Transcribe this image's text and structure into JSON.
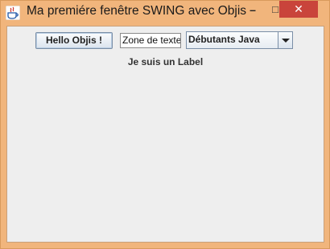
{
  "window": {
    "title": "Ma premiére fenêtre SWING avec Objis",
    "app_icon": "java-cup-icon",
    "controls": {
      "minimize": "–",
      "maximize": "□",
      "close": "✕"
    },
    "accent_color": "#f1b57c",
    "close_color": "#c9443b"
  },
  "content": {
    "button_label": "Hello Objis !",
    "text_field_value": "Zone de texte",
    "combo_selected": "Débutants Java",
    "label_text": "Je suis un Label"
  }
}
